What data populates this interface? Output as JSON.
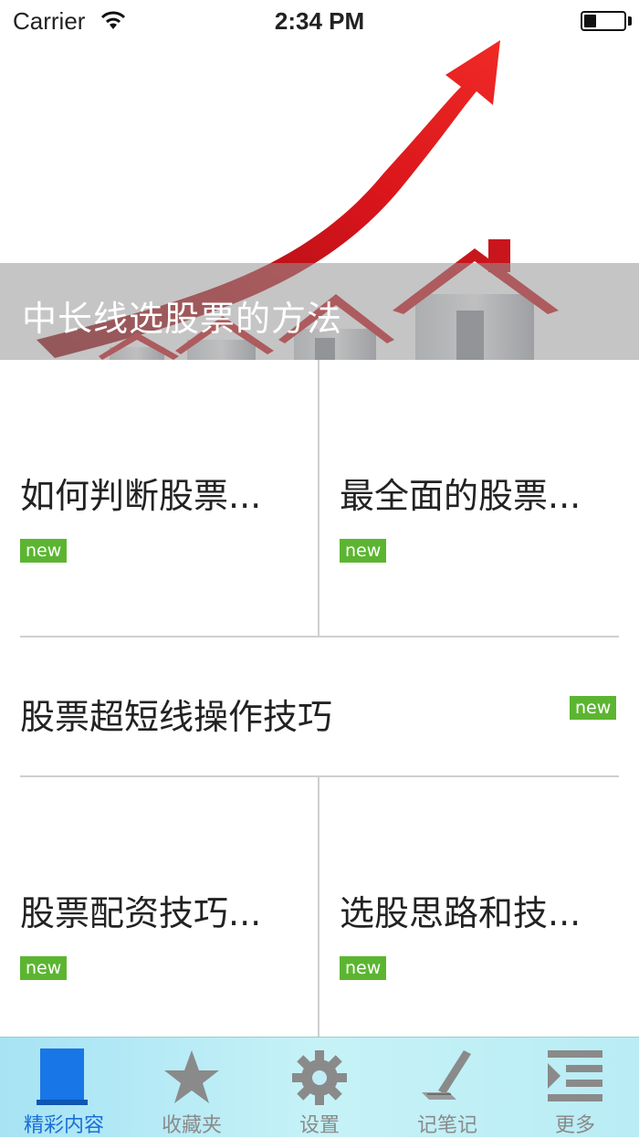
{
  "status_bar": {
    "carrier": "Carrier",
    "time": "2:34 PM",
    "battery_level": 0.3
  },
  "banner": {
    "title": "中长线选股票的方法"
  },
  "articles": [
    {
      "title": "如何判断股票...",
      "badge": "new"
    },
    {
      "title": "最全面的股票...",
      "badge": "new"
    },
    {
      "title": "股票超短线操作技巧",
      "badge": "new"
    },
    {
      "title": "股票配资技巧...",
      "badge": "new"
    },
    {
      "title": "选股思路和技...",
      "badge": "new"
    }
  ],
  "tabbar": {
    "items": [
      {
        "label": "精彩内容",
        "icon": "book-icon",
        "active": true
      },
      {
        "label": "收藏夹",
        "icon": "star-icon",
        "active": false
      },
      {
        "label": "设置",
        "icon": "gear-icon",
        "active": false
      },
      {
        "label": "记笔记",
        "icon": "pen-icon",
        "active": false
      },
      {
        "label": "更多",
        "icon": "more-list-icon",
        "active": false
      }
    ]
  },
  "colors": {
    "badge": "#5cb531",
    "active_tab": "#1b6fd6",
    "inactive_tab": "#8a8a8a",
    "arrow": "#d8141b"
  }
}
